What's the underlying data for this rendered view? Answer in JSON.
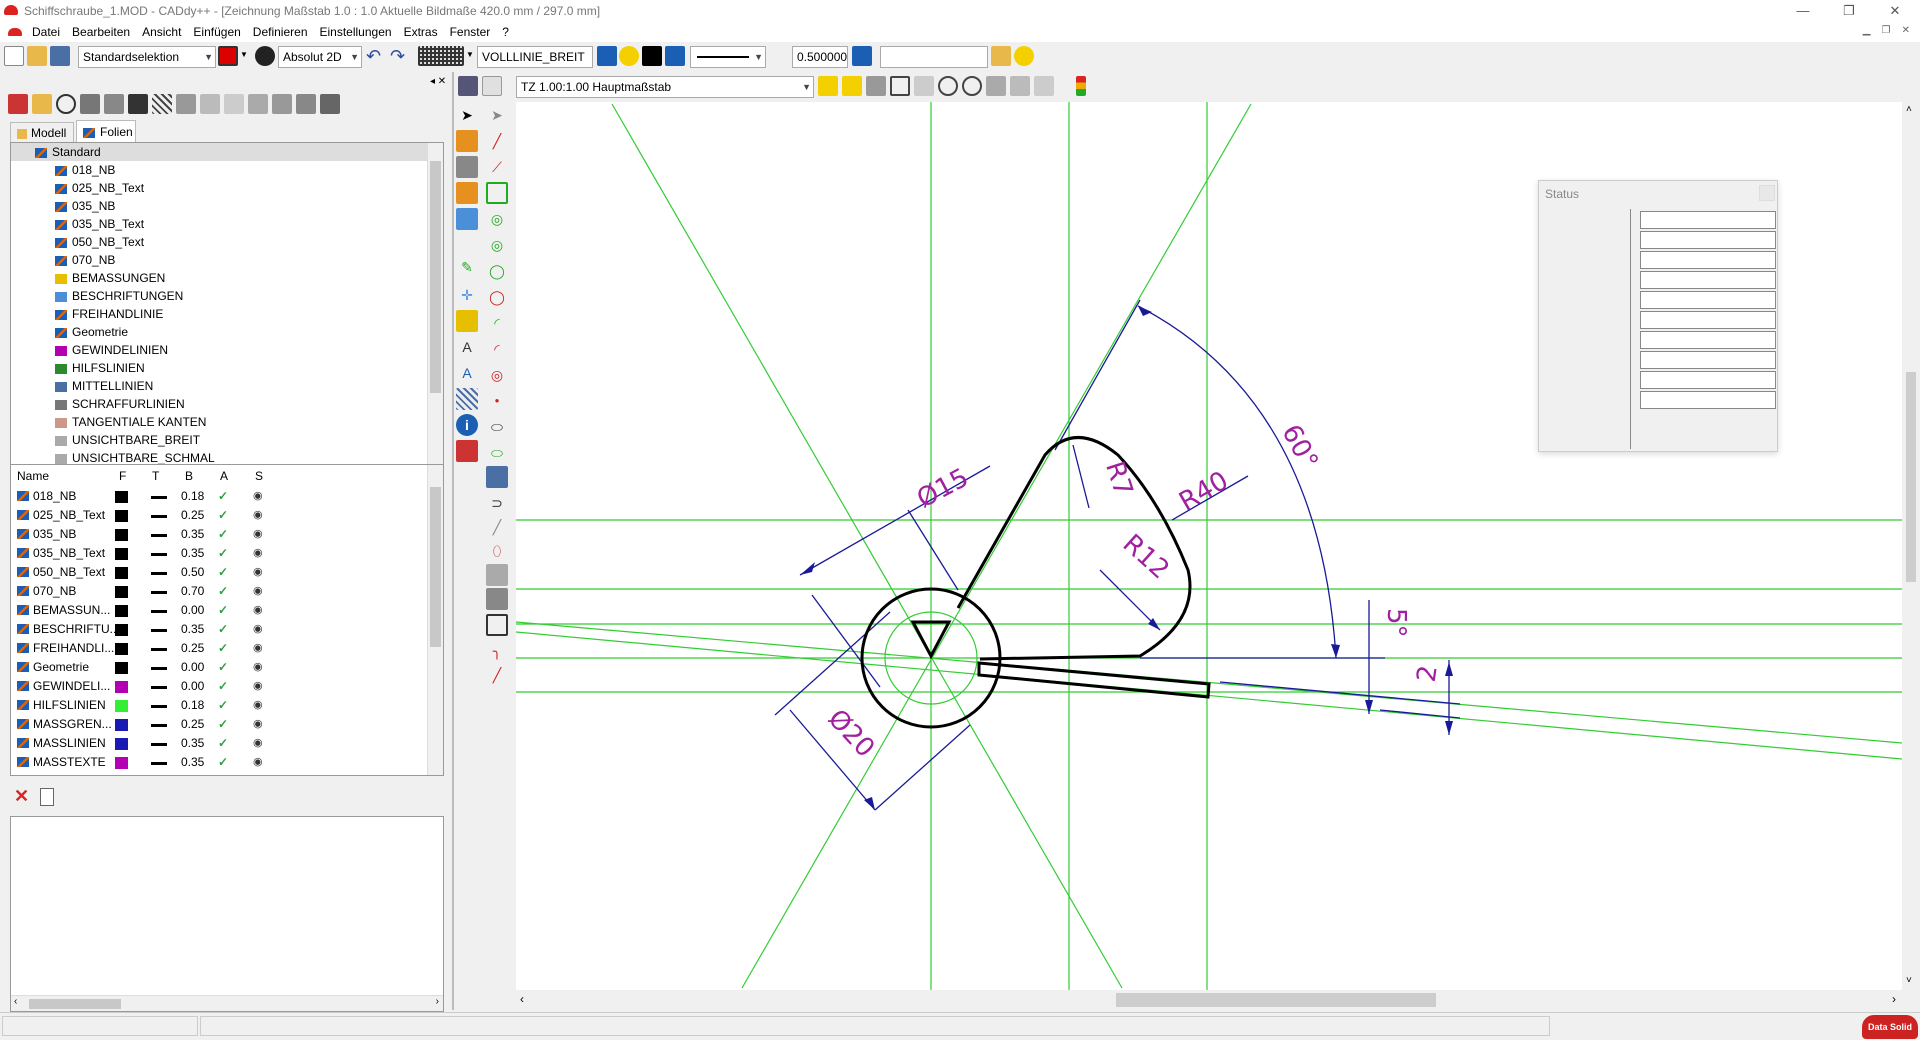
{
  "window": {
    "title": "Schiffschraube_1.MOD  -  CADdy++ - [Zeichnung   Maßstab 1.0 : 1.0   Aktuelle Bildmaße 420.0 mm / 297.0 mm]"
  },
  "menu": [
    "Datei",
    "Bearbeiten",
    "Ansicht",
    "Einfügen",
    "Definieren",
    "Einstellungen",
    "Extras",
    "Fenster",
    "?"
  ],
  "toolbar1": {
    "selection_mode": "Standardselektion",
    "coord_mode": "Absolut 2D",
    "linetype": "VOLLLINIE_BREIT",
    "line_width": "0.500000",
    "search_value": ""
  },
  "toolbar2": {
    "scale": "TZ 1.00:1.00 Hauptmaßstab"
  },
  "tabs": {
    "model": "Modell",
    "layers": "Folien"
  },
  "layer_tree": {
    "root": "Standard",
    "items": [
      "018_NB",
      "025_NB_Text",
      "035_NB",
      "035_NB_Text",
      "050_NB_Text",
      "070_NB",
      "BEMASSUNGEN",
      "BESCHRIFTUNGEN",
      "FREIHANDLINIE",
      "Geometrie",
      "GEWINDELINIEN",
      "HILFSLINIEN",
      "MITTELLINIEN",
      "SCHRAFFURLINIEN",
      "TANGENTIALE KANTEN",
      "UNSICHTBARE_BREIT",
      "UNSICHTBARE_SCHMAL"
    ]
  },
  "layer_table": {
    "headers": [
      "Name",
      "F",
      "T",
      "B",
      "A",
      "S"
    ],
    "rows": [
      {
        "name": "018_NB",
        "color": "#000000",
        "width": "0.18"
      },
      {
        "name": "025_NB_Text",
        "color": "#000000",
        "width": "0.25"
      },
      {
        "name": "035_NB",
        "color": "#000000",
        "width": "0.35"
      },
      {
        "name": "035_NB_Text",
        "color": "#000000",
        "width": "0.35"
      },
      {
        "name": "050_NB_Text",
        "color": "#000000",
        "width": "0.50"
      },
      {
        "name": "070_NB",
        "color": "#000000",
        "width": "0.70"
      },
      {
        "name": "BEMASSUN...",
        "color": "#000000",
        "width": "0.00"
      },
      {
        "name": "BESCHRIFTU...",
        "color": "#000000",
        "width": "0.35"
      },
      {
        "name": "FREIHANDLI...",
        "color": "#000000",
        "width": "0.25"
      },
      {
        "name": "Geometrie",
        "color": "#000000",
        "width": "0.00"
      },
      {
        "name": "GEWINDELI...",
        "color": "#b300b3",
        "width": "0.00"
      },
      {
        "name": "HILFSLINIEN",
        "color": "#33ee33",
        "width": "0.18"
      },
      {
        "name": "MASSGREN...",
        "color": "#1a1ab3",
        "width": "0.25"
      },
      {
        "name": "MASSLINIEN",
        "color": "#1a1ab3",
        "width": "0.35"
      },
      {
        "name": "MASSTEXTE",
        "color": "#b300b3",
        "width": "0.35"
      }
    ]
  },
  "status_window": {
    "title": "Status"
  },
  "drawing": {
    "dimensions": [
      "Ø15",
      "R7",
      "R40",
      "60°",
      "R12",
      "5°",
      "2",
      "Ø20"
    ]
  },
  "brand": {
    "name": "Data Solid"
  },
  "colors": {
    "construction": "#33cc33",
    "dimension_line": "#1a1a99",
    "dimension_text": "#a020a0",
    "geometry": "#000000"
  }
}
